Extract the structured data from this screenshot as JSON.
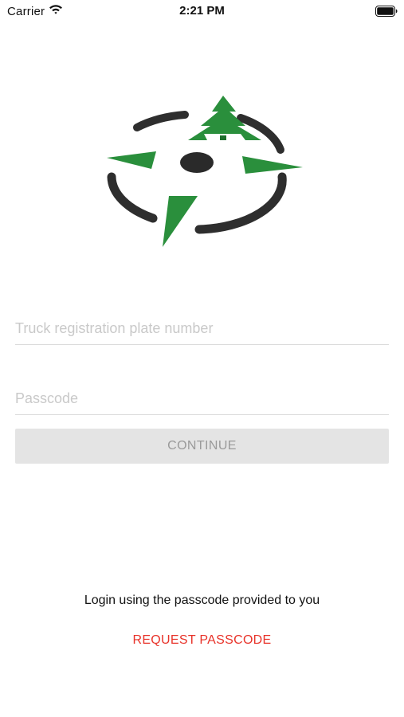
{
  "status_bar": {
    "carrier": "Carrier",
    "time": "2:21 PM",
    "wifi_icon": "wifi-icon",
    "battery_icon": "battery-icon"
  },
  "logo": {
    "icon": "compass-tree-logo",
    "colors": {
      "green": "#2a8f3c",
      "dark_green": "#1e6f2c",
      "dark": "#2e2e2e"
    }
  },
  "form": {
    "plate_placeholder": "Truck registration plate number",
    "plate_value": "",
    "passcode_placeholder": "Passcode",
    "passcode_value": "",
    "continue_label": "CONTINUE"
  },
  "footer": {
    "hint": "Login using the passcode provided to you",
    "request_label": "REQUEST PASSCODE",
    "request_color": "#e8332a"
  }
}
